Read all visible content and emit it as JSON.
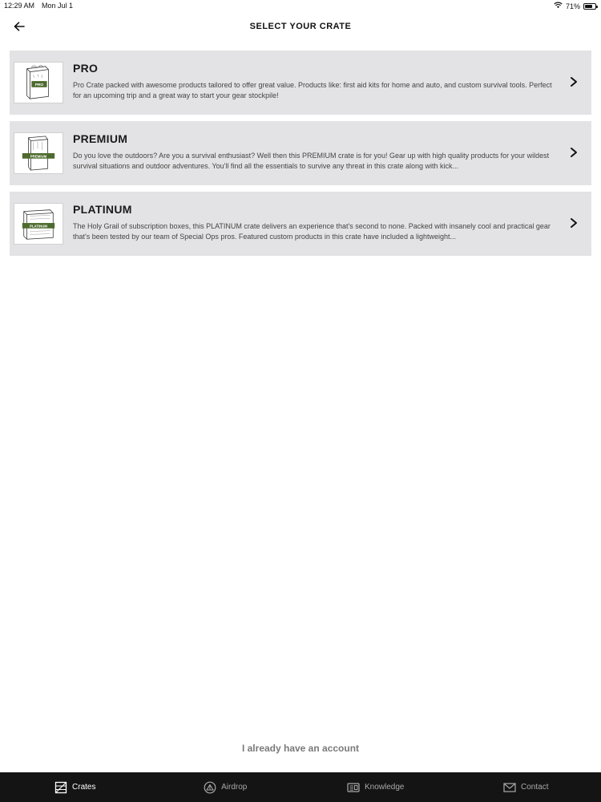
{
  "status_bar": {
    "time": "12:29 AM",
    "date": "Mon Jul 1",
    "battery_percent": "71%",
    "battery_level": 0.71,
    "wifi_icon": "wifi-icon"
  },
  "header": {
    "title": "SELECT YOUR CRATE",
    "back_icon": "arrow-left-icon"
  },
  "crates": [
    {
      "name": "PRO",
      "badge": "PRO",
      "description": "Pro Crate packed with awesome products tailored to offer great value. Products like: first aid kits for home and auto, and custom survival tools. Perfect for an upcoming trip and a great way to start your gear stockpile!"
    },
    {
      "name": "PREMIUM",
      "badge": "PREMIUM",
      "description": "Do you love the outdoors? Are you a survival enthusiast? Well then this PREMIUM crate is for you! Gear up with high quality products for your wildest survival situations and outdoor adventures. You'll find all the essentials to survive any threat in this crate along with kick..."
    },
    {
      "name": "PLATINUM",
      "badge": "PLATINUM",
      "description": "The Holy Grail of subscription boxes, this PLATINUM crate delivers an experience that's second to none. Packed with insanely cool and practical gear that's been tested by our team of Special Ops pros. Featured custom products in this crate have included a lightweight..."
    }
  ],
  "account_link": "I already have an account",
  "tabs": [
    {
      "label": "Crates",
      "icon": "crate-icon",
      "active": true
    },
    {
      "label": "Airdrop",
      "icon": "airdrop-icon",
      "active": false
    },
    {
      "label": "Knowledge",
      "icon": "knowledge-icon",
      "active": false
    },
    {
      "label": "Contact",
      "icon": "mail-icon",
      "active": false
    }
  ],
  "colors": {
    "card_bg": "#e3e3e5",
    "tab_bar_bg": "#141414",
    "badge_green": "#4e6b2f",
    "link_gray": "#7a7a7a"
  }
}
